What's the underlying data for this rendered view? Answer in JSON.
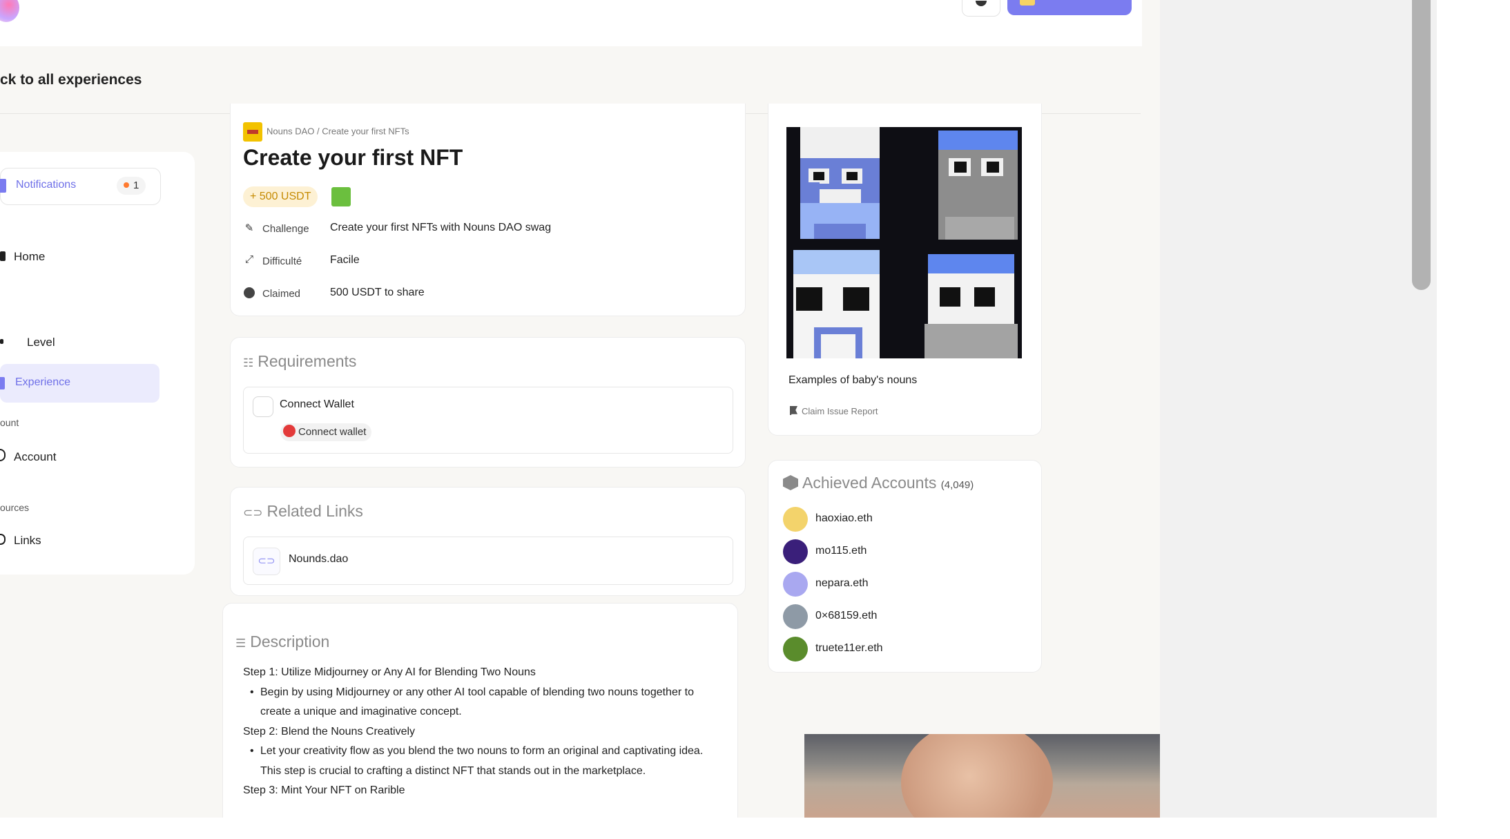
{
  "header": {
    "back_link": "ck to all experiences"
  },
  "sidebar": {
    "notifications_label": "Notifications",
    "notifications_count": "1",
    "home_label": "Home",
    "level_label": "Level",
    "experience_label": "Experience",
    "account_section": "ount",
    "account_label": "Account",
    "resources_section": "ources",
    "links_label": "Links"
  },
  "experience": {
    "breadcrumb": "Nouns DAO / Create your first NFTs",
    "title": "Create your first NFT",
    "reward": "+ 500 USDT",
    "meta": [
      {
        "label": "Challenge",
        "value": "Create your first NFTs with Nouns DAO swag",
        "icon": "pencil-icon"
      },
      {
        "label": "Difficulté",
        "value": "Facile",
        "icon": "expand-arrows-icon"
      },
      {
        "label": "Claimed",
        "value": "500 USDT to share",
        "icon": "check-circle-icon"
      }
    ]
  },
  "requirements": {
    "title": "Requirements",
    "item_label": "Connect Wallet",
    "connect_button": "Connect wallet"
  },
  "related_links": {
    "title": "Related Links",
    "link_label": "Nounds.dao"
  },
  "description": {
    "title": "Description",
    "step1": "Step 1: Utilize Midjourney or Any AI for Blending Two Nouns",
    "bullet1": "Begin by using Midjourney or any other AI tool capable of blending two nouns together to create a unique and imaginative concept.",
    "step2": "Step 2: Blend the Nouns Creatively",
    "bullet2": "Let your creativity flow as you blend the two nouns to form an original and captivating idea. This step is crucial to crafting a distinct NFT that stands out in the marketplace.",
    "step3": "Step 3: Mint Your NFT on Rarible"
  },
  "gallery": {
    "caption": "Examples of baby's nouns",
    "report_link": "Claim Issue Report"
  },
  "achieved": {
    "title": "Achieved Accounts",
    "count": "(4,049)",
    "accounts": [
      {
        "name": "haoxiao.eth",
        "color": "#f3d36b"
      },
      {
        "name": "mo115.eth",
        "color": "#3a1f7a"
      },
      {
        "name": "nepara.eth",
        "color": "#a9a8f0"
      },
      {
        "name": "0×68159.eth",
        "color": "#8e9aa6"
      },
      {
        "name": "truete11er.eth",
        "color": "#5a8c2c"
      }
    ]
  },
  "colors": {
    "accent": "#7b7cf0",
    "reward_bg": "#fdf1d4",
    "reward_text": "#c58a00",
    "error": "#e33a3a"
  }
}
